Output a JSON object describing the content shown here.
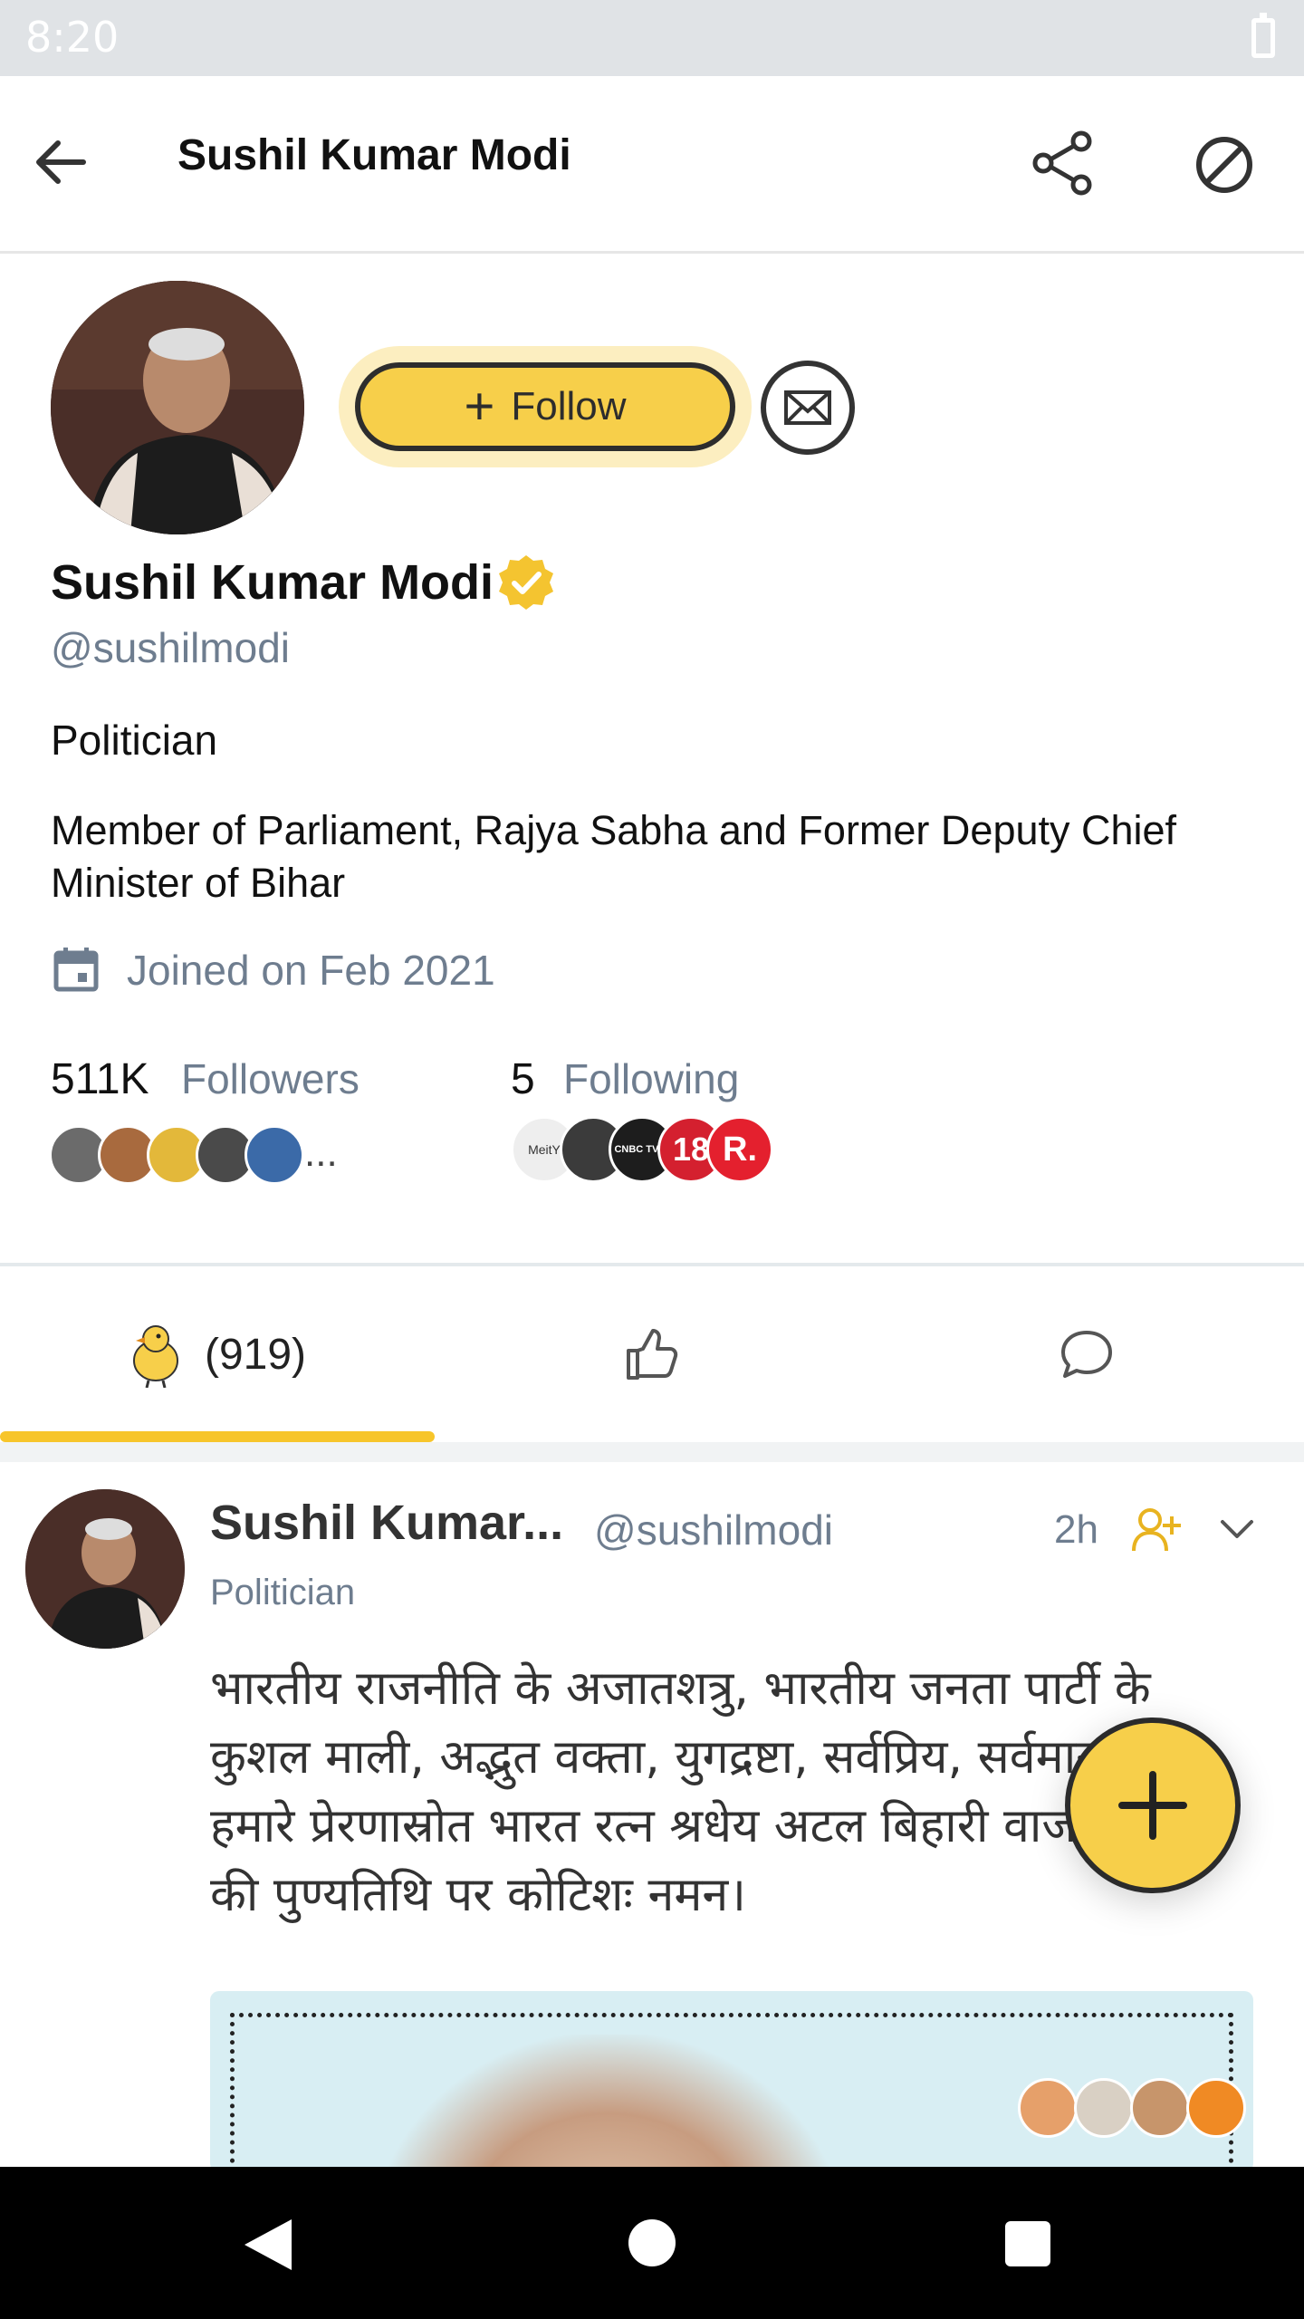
{
  "status_bar": {
    "time": "8:20"
  },
  "app_bar": {
    "title": "Sushil Kumar Modi"
  },
  "profile": {
    "follow_label": "Follow",
    "name": "Sushil Kumar Modi",
    "handle": "@sushilmodi",
    "profession": "Politician",
    "bio": "Member of Parliament, Rajya Sabha and Former Deputy Chief Minister of Bihar",
    "joined": "Joined on Feb 2021",
    "followers": {
      "count": "511K",
      "label": "Followers",
      "more": "..."
    },
    "following": {
      "count": "5",
      "label": "Following"
    },
    "following_avatars": [
      "MeitY",
      "",
      "CNBC TV18",
      "18",
      "R."
    ]
  },
  "tabs": [
    {
      "icon": "koo-bird-icon",
      "count": "(919)",
      "active": true
    },
    {
      "icon": "thumbs-up-icon",
      "count": ""
    },
    {
      "icon": "comment-icon",
      "count": ""
    }
  ],
  "post": {
    "author": "Sushil Kumar...",
    "handle": "@sushilmodi",
    "time": "2h",
    "profession": "Politician",
    "text": "भारतीय राजनीति के अजातशत्रु, भारतीय जनता पार्टी के कुशल माली, अद्भुत वक्ता, युगद्रष्टा, सर्वप्रिय, सर्वमान्य, हमारे प्रेरणास्रोत भारत रत्न श्रधेय अटल बिहारी वाजपेयी जी की पुण्यतिथि पर कोटिशः नमन।"
  },
  "colors": {
    "accent": "#f7cf4a",
    "verified": "#f4c430",
    "muted": "#6e7d8f"
  }
}
